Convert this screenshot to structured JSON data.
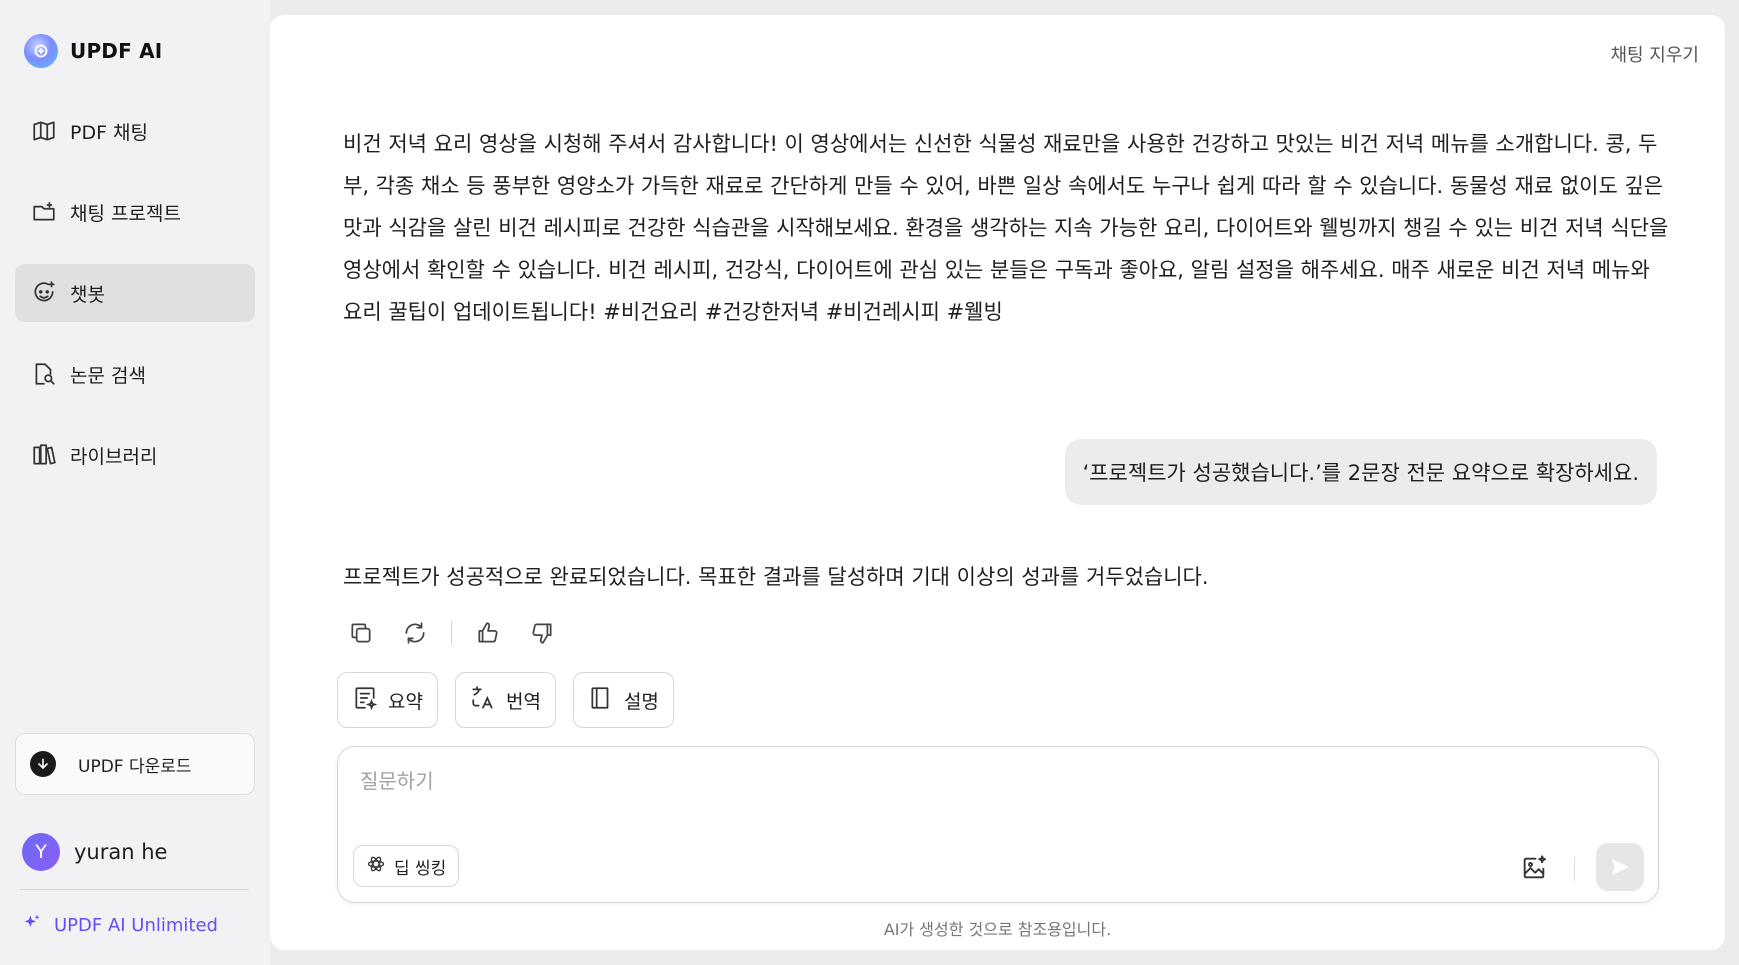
{
  "brand": {
    "name": "UPDF AI"
  },
  "sidebar": {
    "items": [
      {
        "label": "PDF 채팅",
        "icon": "map-book-icon"
      },
      {
        "label": "채팅 프로젝트",
        "icon": "folder-plus-icon"
      },
      {
        "label": "챗봇",
        "icon": "chatbot-icon",
        "active": true
      },
      {
        "label": "논문 검색",
        "icon": "document-search-icon"
      },
      {
        "label": "라이브러리",
        "icon": "library-icon"
      }
    ],
    "download_label": "UPDF 다운로드",
    "user": {
      "initial": "Y",
      "name": "yuran he"
    },
    "unlimited_label": "UPDF AI Unlimited"
  },
  "header": {
    "clear_chat_label": "채팅 지우기"
  },
  "conversation": {
    "ai_message_1": "비건 저녁 요리 영상을 시청해 주셔서 감사합니다! 이 영상에서는 신선한 식물성 재료만을 사용한 건강하고 맛있는 비건 저녁 메뉴를 소개합니다. 콩, 두부, 각종 채소 등 풍부한 영양소가 가득한 재료로 간단하게 만들 수 있어, 바쁜 일상 속에서도 누구나 쉽게 따라 할 수 있습니다. 동물성 재료 없이도 깊은 맛과 식감을 살린 비건 레시피로 건강한 식습관을 시작해보세요. 환경을 생각하는 지속 가능한 요리, 다이어트와 웰빙까지 챙길 수 있는 비건 저녁 식단을 영상에서 확인할 수 있습니다. 비건 레시피, 건강식, 다이어트에 관심 있는 분들은 구독과 좋아요, 알림 설정을 해주세요. 매주 새로운 비건 저녁 메뉴와 요리 꿀팁이 업데이트됩니다! #비건요리 #건강한저녁 #비건레시피 #웰빙",
    "user_message": "‘프로젝트가 성공했습니다.’를 2문장 전문 요약으로 확장하세요.",
    "ai_message_2": "프로젝트가 성공적으로 완료되었습니다. 목표한 결과를 달성하며 기대 이상의 성과를 거두었습니다."
  },
  "quick_actions": [
    {
      "label": "요약",
      "icon": "summary-icon"
    },
    {
      "label": "번역",
      "icon": "translate-icon"
    },
    {
      "label": "설명",
      "icon": "book-icon"
    }
  ],
  "composer": {
    "placeholder": "질문하기",
    "deep_think_label": "딥 씽킹"
  },
  "disclaimer": "AI가 생성한 것으로 참조용입니다.",
  "colors": {
    "accent": "#6a4cf5",
    "active_nav": "#e0e0e2",
    "bubble": "#ececee"
  }
}
